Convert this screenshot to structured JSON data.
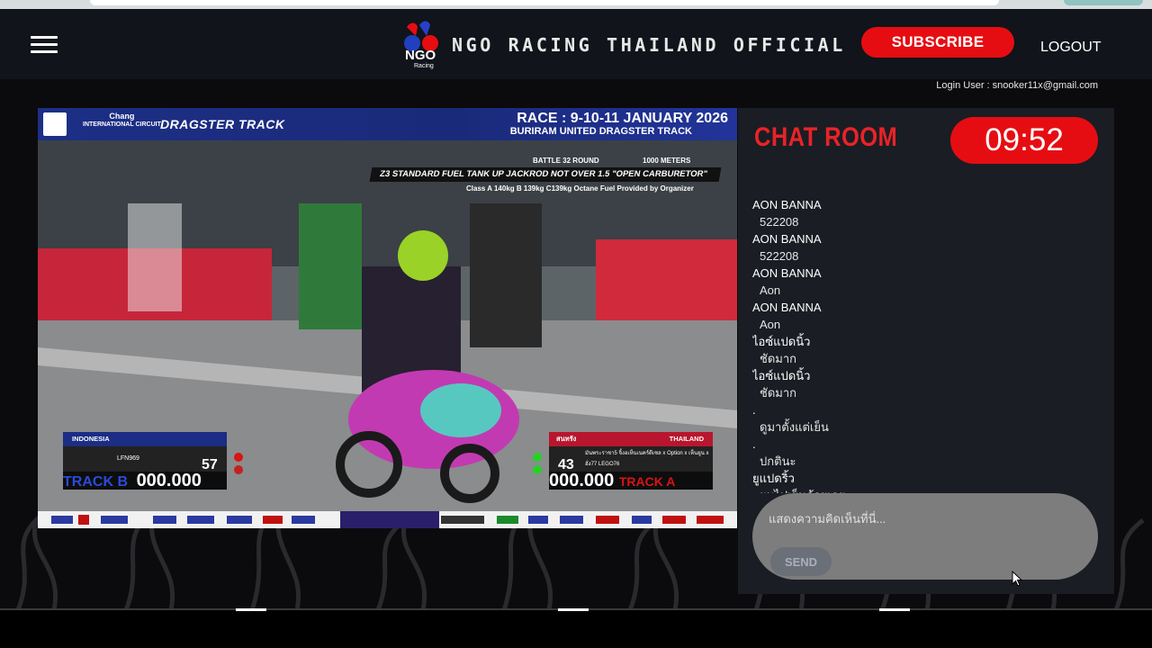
{
  "header": {
    "brand_title": "NGO RACING THAILAND OFFICIAL",
    "subscribe_label": "SUBSCRIBE",
    "logout_label": "LOGOUT",
    "login_user": "Login User : snooker11x@gmail.com"
  },
  "video": {
    "race_title": "RACE : 9-10-11 JANUARY 2026",
    "race_subtitle": "BURIRAM UNITED DRAGSTER TRACK",
    "sponsor_chang": "Chang",
    "sponsor_chang_sub": "INTERNATIONAL CIRCUIT",
    "sponsor_dragster": "DRAGSTER TRACK",
    "battle": "BATTLE 32 ROUND",
    "meters": "1000 METERS",
    "class_title": "Z3 STANDARD FUEL TANK UP JACKROD NOT OVER 1.5 \"OPEN CARBURETOR\"",
    "class_sub": "Class A 140kg B 139kg C139kg Octane Fuel Provided by Organizer",
    "left": {
      "country": "INDONESIA",
      "rider": "LFN969",
      "number": "57",
      "track": "TRACK B",
      "time": "000.000"
    },
    "right": {
      "country": "THAILAND",
      "team": "สนทรัง",
      "rider": "มันพระราชา5 จิ้งอเห็นเนคร์ดีเซล x Option x เห็นยูน x ฮั่ง77 LEGO76",
      "number": "43",
      "track": "TRACK A",
      "time": "000.000"
    }
  },
  "chat": {
    "title": "CHAT ROOM",
    "timer": "09:52",
    "messages": [
      {
        "user": "AON BANNA",
        "text": "522208"
      },
      {
        "user": "AON BANNA",
        "text": "522208"
      },
      {
        "user": "AON BANNA",
        "text": "Aon"
      },
      {
        "user": "AON BANNA",
        "text": "Aon"
      },
      {
        "user": "ไอซ์แปดนิ้ว",
        "text": "ชัดมาก"
      },
      {
        "user": "ไอซ์แปดนิ้ว",
        "text": "ชัดมาก"
      },
      {
        "user": ".",
        "text": "ดูมาตั้งแต่เย็น"
      },
      {
        "user": ".",
        "text": "ปกตินะ"
      },
      {
        "user": "ยูแปดริ้ว",
        "text": "ผมไปเย็นด้วยเลย"
      }
    ],
    "input_placeholder": "แสดงความคิดเห็นที่นี่...",
    "send_label": "SEND"
  },
  "colors": {
    "accent_red": "#e60d12",
    "chat_title_red": "#e82328",
    "panel_bg": "#1a1d23",
    "topbar_bg": "#11141a"
  }
}
